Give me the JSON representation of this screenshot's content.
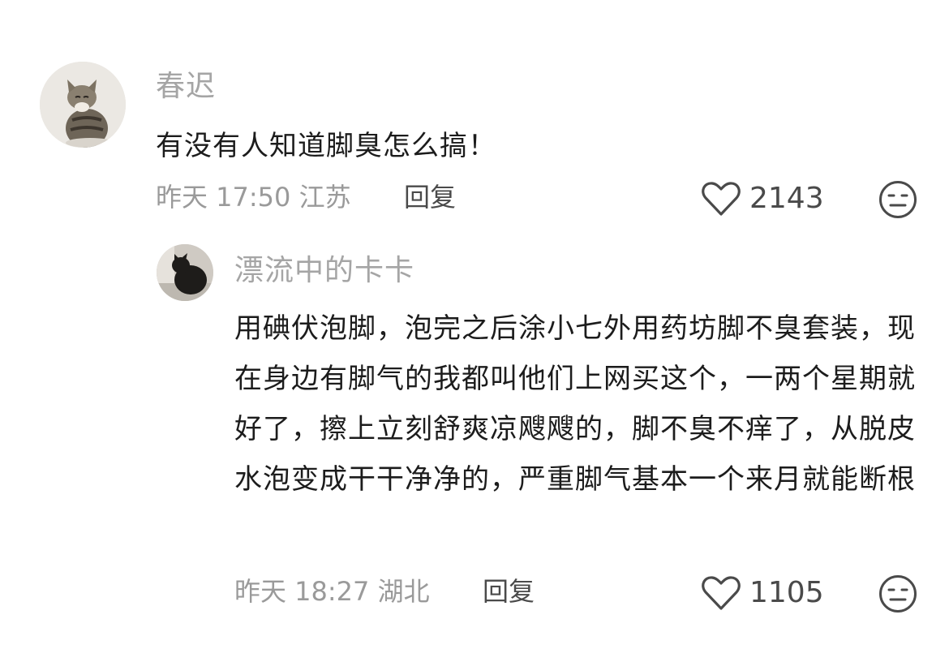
{
  "comments": [
    {
      "author": "春迟",
      "text": "有没有人知道脚臭怎么搞！",
      "time": "昨天 17:50",
      "location": "江苏",
      "reply_label": "回复",
      "likes": "2143",
      "avatar_icon": "cat-avatar-icon"
    }
  ],
  "replies": [
    {
      "author": "漂流中的卡卡",
      "text": "用碘伏泡脚，泡完之后涂小七外用药坊脚不臭套装，现在身边有脚气的我都叫他们上网买这个，一两个星期就好了，擦上立刻舒爽凉飕飕的，脚不臭不痒了，从脱皮水泡变成干干净净的，严重脚气基本一个来月就能断根",
      "time": "昨天 18:27",
      "location": "湖北",
      "reply_label": "回复",
      "likes": "1105",
      "avatar_icon": "black-cat-avatar-icon"
    }
  ],
  "icons": {
    "like": "heart-outline-icon",
    "dislike": "neutral-face-icon"
  },
  "colors": {
    "name": "#a5a5a5",
    "text": "#1c1c1c",
    "meta": "#9a9a9a",
    "action": "#4a4a4a"
  }
}
